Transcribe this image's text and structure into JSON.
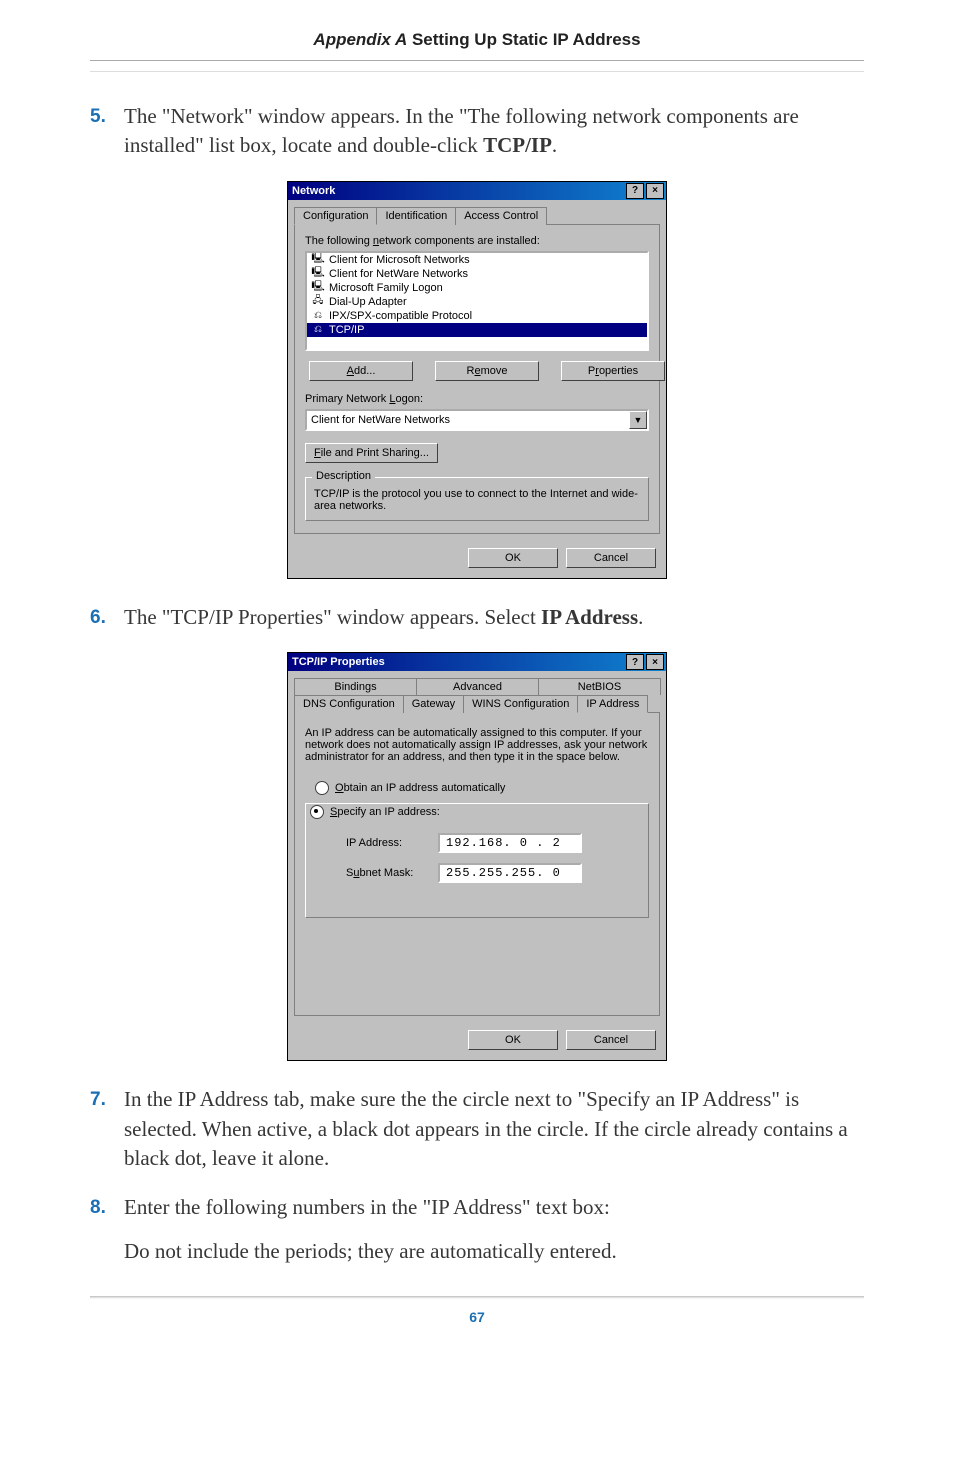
{
  "header": {
    "italic": "Appendix A",
    "rest": "  Setting Up Static IP Address"
  },
  "step5": {
    "num": "5.",
    "text_a": "The \"Network\" window appears. In the \"The following network components are installed\" list box, locate and double-click ",
    "text_b": "TCP/IP",
    "text_c": "."
  },
  "network_dialog": {
    "title": "Network",
    "help": "?",
    "close": "×",
    "tabs": [
      "Configuration",
      "Identification",
      "Access Control"
    ],
    "list_label": "The following network components are installed:",
    "list_label_u": "n",
    "items": [
      "Client for Microsoft Networks",
      "Client for NetWare Networks",
      "Microsoft Family Logon",
      "Dial-Up Adapter",
      "IPX/SPX-compatible Protocol",
      "TCP/IP"
    ],
    "add_btn": "Add...",
    "add_u": "A",
    "remove_btn": "Remove",
    "remove_u": "R",
    "props_btn": "Properties",
    "props_u": "r",
    "logon_label": "Primary Network Logon:",
    "logon_u": "L",
    "logon_value": "Client for NetWare Networks",
    "fps_btn": "File and Print Sharing...",
    "fps_u": "F",
    "desc_legend": "Description",
    "desc_text": "TCP/IP is the protocol you use to connect to the Internet and wide-area networks.",
    "ok": "OK",
    "cancel": "Cancel"
  },
  "step6": {
    "num": "6.",
    "text_a": "The \"TCP/IP Properties\" window appears. Select ",
    "text_b": "IP Address",
    "text_c": "."
  },
  "tcpip_dialog": {
    "title": "TCP/IP Properties",
    "help": "?",
    "close": "×",
    "tabs_row1": [
      "Bindings",
      "Advanced",
      "NetBIOS"
    ],
    "tabs_row2": [
      "DNS Configuration",
      "Gateway",
      "WINS Configuration",
      "IP Address"
    ],
    "intro": "An IP address can be automatically assigned to this computer. If your network does not automatically assign IP addresses, ask your network administrator for an address, and then type it in the space below.",
    "radio_auto": "Obtain an IP address automatically",
    "radio_auto_u": "O",
    "radio_spec": "Specify an IP address:",
    "radio_spec_u": "S",
    "ip_label": "IP Address:",
    "ip_value": "192.168. 0 . 2",
    "mask_label": "Subnet Mask:",
    "mask_u": "u",
    "mask_value": "255.255.255. 0",
    "ok": "OK",
    "cancel": "Cancel"
  },
  "step7": {
    "num": "7.",
    "text": "In the IP Address tab, make sure the the circle next to \"Specify an IP Address\" is selected. When active, a black dot appears in the circle. If the circle already contains a black dot, leave it alone."
  },
  "step8": {
    "num": "8.",
    "line1": "Enter the following numbers in the \"IP Address\" text box:",
    "line2": "Do not include the periods; they are automatically entered."
  },
  "page_number": "67"
}
